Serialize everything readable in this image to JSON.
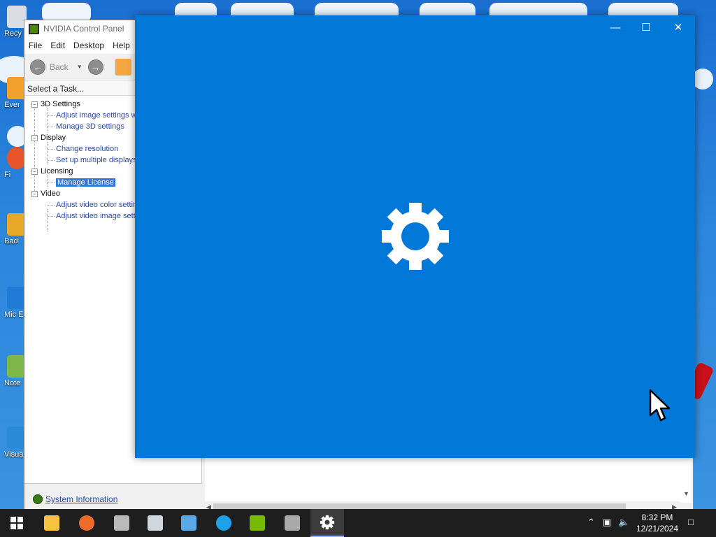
{
  "desktop": {
    "icons": [
      {
        "label": "Recy"
      },
      {
        "label": "Ever"
      },
      {
        "label": "Fi"
      },
      {
        "label": "Bad"
      },
      {
        "label": "Mic E"
      },
      {
        "label": "Note"
      },
      {
        "label": "Visua C"
      }
    ]
  },
  "nvidia_window": {
    "title": "NVIDIA Control Panel",
    "menu": [
      "File",
      "Edit",
      "Desktop",
      "Help"
    ],
    "toolbar": {
      "back_label": "Back"
    },
    "task_header": "Select a Task...",
    "tree": [
      {
        "category": "3D Settings",
        "items": [
          "Adjust image settings w",
          "Manage 3D settings"
        ]
      },
      {
        "category": "Display",
        "items": [
          "Change resolution",
          "Set up multiple displays"
        ]
      },
      {
        "category": "Licensing",
        "items": [
          "Manage License"
        ]
      },
      {
        "category": "Video",
        "items": [
          "Adjust video color settin",
          "Adjust video image sett"
        ]
      }
    ],
    "selected_item": "Manage License",
    "system_information_link": "System Information"
  },
  "splash_window": {
    "background_color": "#0078d7",
    "icon": "gear-icon",
    "controls": {
      "minimize": "—",
      "maximize": "☐",
      "close": "✕"
    }
  },
  "taskbar": {
    "apps": [
      "start-icon",
      "file-explorer-icon",
      "firefox-icon",
      "app-icon-1",
      "app-icon-2",
      "app-icon-3",
      "edge-icon",
      "nvidia-icon",
      "app-icon-4",
      "settings-icon"
    ],
    "active_app": "settings-icon",
    "clock": {
      "time": "8:32 PM",
      "date": "12/21/2024"
    }
  }
}
